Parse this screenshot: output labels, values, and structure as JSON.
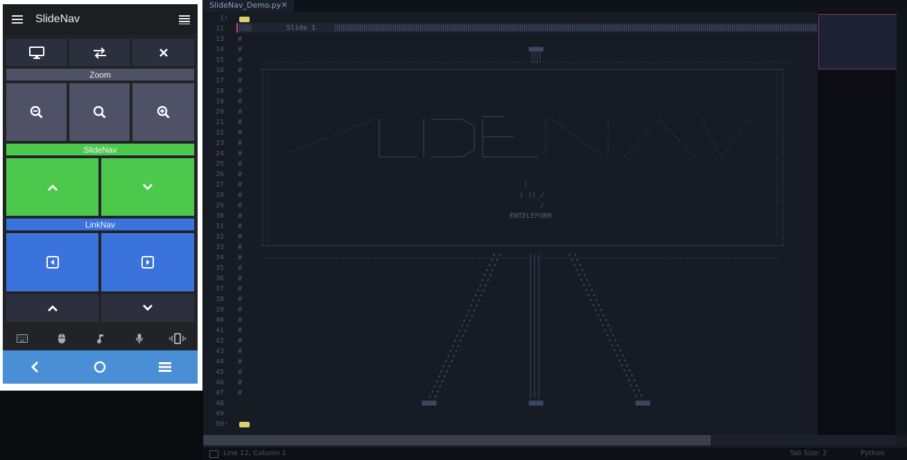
{
  "phone": {
    "title": "SlideNav",
    "sections": {
      "zoom": "Zoom",
      "slidenav": "SlideNav",
      "linknav": "LinkNav"
    },
    "bottom_icons": [
      "keyboard-icon",
      "mouse-icon",
      "music-icon",
      "mic-icon",
      "vibrate-icon"
    ],
    "colors": {
      "green": "#4cc94c",
      "blue": "#3b73dc",
      "grey": "#4f5166",
      "dark": "#2b2f3e",
      "navbar": "#4a8fd6"
    }
  },
  "editor": {
    "tab_name": "SlideNav_Demo.py",
    "line_numbers": [
      "1",
      "12",
      "13",
      "14",
      "15",
      "16",
      "17",
      "18",
      "19",
      "20",
      "21",
      "22",
      "23",
      "24",
      "25",
      "26",
      "27",
      "28",
      "29",
      "30",
      "31",
      "32",
      "33",
      "34",
      "35",
      "36",
      "37",
      "38",
      "39",
      "40",
      "41",
      "42",
      "43",
      "44",
      "45",
      "46",
      "47",
      "48",
      "49",
      "50"
    ],
    "slide_label": "Slide 1",
    "fold_marker": "...",
    "art_lines": {
      "l27": ")",
      "l28": "( )(_/",
      "l29": "/",
      "l30": "ENTELEFORM"
    },
    "status": {
      "position": "Line 12, Column 1",
      "tab_size": "Tab Size: 2",
      "language": "Python"
    }
  }
}
